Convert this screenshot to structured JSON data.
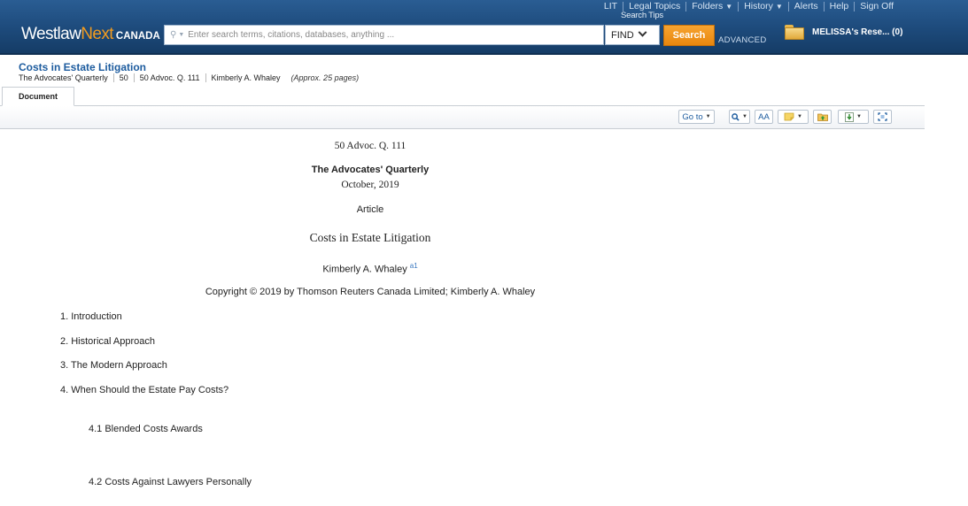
{
  "header": {
    "util_nav": {
      "lit": "LIT",
      "legal_topics": "Legal Topics",
      "folders": "Folders",
      "history": "History",
      "alerts": "Alerts",
      "help": "Help",
      "sign_off": "Sign Off"
    },
    "search_tips": "Search Tips",
    "logo": {
      "westlaw": "Westlaw",
      "next": "Next",
      "canada": "CANADA"
    },
    "search": {
      "placeholder": "Enter search terms, citations, databases, anything ...",
      "value": ""
    },
    "find_select": "FIND",
    "search_button": "Search",
    "advanced_link": "ADVANCED",
    "folder_label": "MELISSA's Rese... (0)"
  },
  "document_header": {
    "title": "Costs in Estate Litigation",
    "meta": {
      "journal": "The Advocates' Quarterly",
      "volume": "50",
      "citation": "50 Advoc. Q. 111",
      "author": "Kimberly A. Whaley",
      "pages": "(Approx. 25 pages)"
    }
  },
  "tabs": {
    "document": "Document"
  },
  "toolbar": {
    "goto": "Go to",
    "icons": [
      "search-in-document-icon",
      "font-size-icon",
      "annotation-icon",
      "save-to-folder-icon",
      "download-icon",
      "full-screen-icon"
    ],
    "font_size_label": "AA"
  },
  "document": {
    "citation": "50 Advoc. Q. 111",
    "journal": "The Advocates' Quarterly",
    "date": "October, 2019",
    "type": "Article",
    "title": "Costs in Estate Litigation",
    "author": "Kimberly A. Whaley",
    "footnote_ref": "a1",
    "copyright": "Copyright © 2019 by Thomson Reuters Canada Limited; Kimberly A. Whaley",
    "toc": [
      {
        "text": "1. Introduction"
      },
      {
        "text": "2. Historical Approach"
      },
      {
        "text": "3. The Modern Approach"
      },
      {
        "text": "4. When Should the Estate Pay Costs?"
      },
      {
        "text": "4.1 Blended Costs Awards"
      },
      {
        "text": "4.2 Costs Against Lawyers Personally"
      }
    ]
  },
  "colors": {
    "header_blue": "#1d4a7b",
    "accent_orange": "#f39c1f",
    "link_blue": "#1c5b9e"
  }
}
